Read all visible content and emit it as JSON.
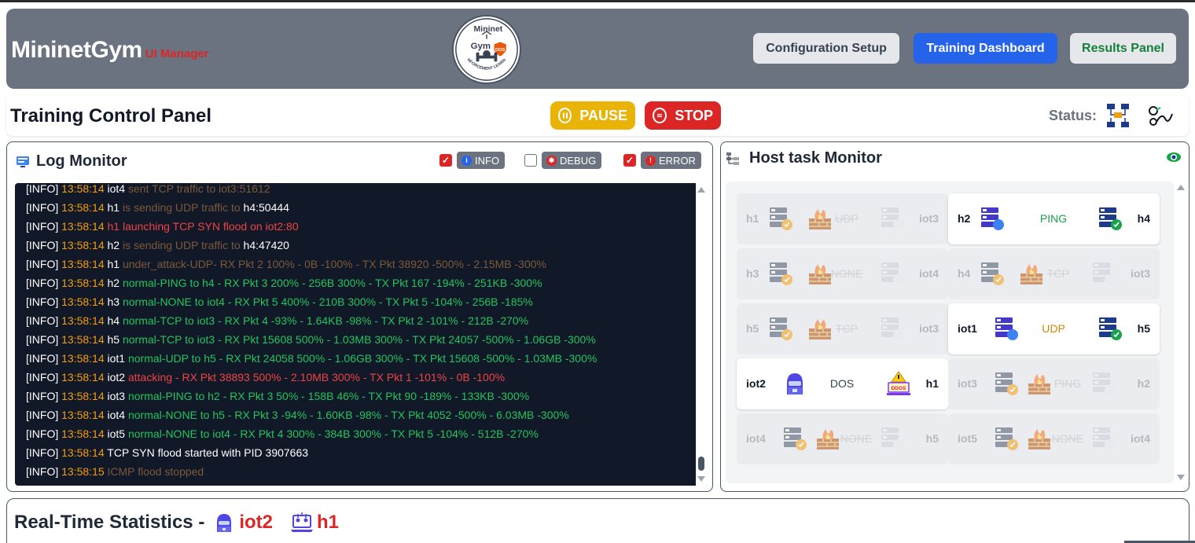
{
  "app": {
    "title": "MininetGym",
    "subtitle": "UI Manager",
    "logo_text": [
      "Mininet",
      "Gym",
      "DOS",
      "REINFORCEMENT LEARNING"
    ]
  },
  "nav": {
    "config_label": "Configuration Setup",
    "dashboard_label": "Training Dashboard",
    "results_label": "Results Panel"
  },
  "control": {
    "title": "Training Control Panel",
    "pause_label": "PAUSE",
    "stop_label": "STOP",
    "status_label": "Status:"
  },
  "log_monitor": {
    "title": "Log Monitor",
    "filters": [
      {
        "label": "INFO",
        "checked": true,
        "dot_color": "#2563eb",
        "icon": "info-icon"
      },
      {
        "label": "DEBUG",
        "checked": false,
        "dot_color": "#dc2626",
        "icon": "bug-icon"
      },
      {
        "label": "ERROR",
        "checked": true,
        "dot_color": "#dc2626",
        "icon": "alert-icon"
      }
    ],
    "lines": [
      {
        "level": "[INFO]",
        "time": "13:58:14",
        "host": "iot4",
        "msg": " sent TCP traffic to iot3:51612",
        "style": "dim"
      },
      {
        "level": "[INFO]",
        "time": "13:58:14",
        "host": "h1",
        "msg": " is sending UDP traffic to ",
        "target": "h4:50444",
        "style": "dim"
      },
      {
        "level": "[INFO]",
        "time": "13:58:14",
        "host": "h1 launching TCP SYN flood on iot2:80",
        "msg": "",
        "style": "red"
      },
      {
        "level": "[INFO]",
        "time": "13:58:14",
        "host": "h2",
        "msg": " is sending UDP traffic to ",
        "target": "h4:47420",
        "style": "dim"
      },
      {
        "level": "[INFO]",
        "time": "13:58:14",
        "host": "h1",
        "msg": " under_attack-UDP- RX Pkt 2 100% - 0B -100% - TX Pkt 38920 -500% - 2.15MB -300%",
        "style": "dim"
      },
      {
        "level": "[INFO]",
        "time": "13:58:14",
        "host": "h2",
        "msg": " normal-PING to h4 - RX Pkt 3 200% - 256B 300% - TX Pkt 167 -194% - 251KB -300%",
        "style": "green"
      },
      {
        "level": "[INFO]",
        "time": "13:58:14",
        "host": "h3",
        "msg": " normal-NONE to iot4 - RX Pkt 5 400% - 210B 300% - TX Pkt 5 -104% - 256B -185%",
        "style": "green"
      },
      {
        "level": "[INFO]",
        "time": "13:58:14",
        "host": "h4",
        "msg": " normal-TCP to iot3 - RX Pkt 4 -93% - 1.64KB -98% - TX Pkt 2 -101% - 212B -270%",
        "style": "green"
      },
      {
        "level": "[INFO]",
        "time": "13:58:14",
        "host": "h5",
        "msg": " normal-TCP to iot3 - RX Pkt 15608 500% - 1.03MB 300% - TX Pkt 24057 -500% - 1.06GB -300%",
        "style": "green"
      },
      {
        "level": "[INFO]",
        "time": "13:58:14",
        "host": "iot1",
        "msg": " normal-UDP to h5 - RX Pkt 24058 500% - 1.06GB 300% - TX Pkt 15608 -500% - 1.03MB -300%",
        "style": "green"
      },
      {
        "level": "[INFO]",
        "time": "13:58:14",
        "host": "iot2",
        "msg": " attacking - RX Pkt 38893 500% - 2.10MB 300% - TX Pkt 1 -101% - 0B -100%",
        "style": "red"
      },
      {
        "level": "[INFO]",
        "time": "13:58:14",
        "host": "iot3",
        "msg": " normal-PING to h2 - RX Pkt 3 50% - 158B 46% - TX Pkt 90 -189% - 133KB -300%",
        "style": "green"
      },
      {
        "level": "[INFO]",
        "time": "13:58:14",
        "host": "iot4",
        "msg": " normal-NONE to h5 - RX Pkt 3 -94% - 1.60KB -98% - TX Pkt 4052 -500% - 6.03MB -300%",
        "style": "green"
      },
      {
        "level": "[INFO]",
        "time": "13:58:14",
        "host": "iot5",
        "msg": " normal-NONE to iot4 - RX Pkt 4 300% - 384B 300% - TX Pkt 5 -104% - 512B -270%",
        "style": "green"
      },
      {
        "level": "[INFO]",
        "time": "13:58:14",
        "host": "TCP SYN flood started with PID 3907663",
        "msg": "",
        "style": "white"
      },
      {
        "level": "[INFO]",
        "time": "13:58:15",
        "host": "",
        "msg": "ICMP flood stopped",
        "style": "dim"
      }
    ]
  },
  "host_monitor": {
    "title": "Host task Monitor",
    "cards": [
      {
        "src": "h1",
        "task": "UDP",
        "dst": "iot3",
        "active": false,
        "task_color": "#16a34a"
      },
      {
        "src": "h2",
        "task": "PING",
        "dst": "h4",
        "active": true,
        "task_color": "#16a34a"
      },
      {
        "src": "h3",
        "task": "NONE",
        "dst": "iot4",
        "active": false,
        "task_color": "#16a34a"
      },
      {
        "src": "h4",
        "task": "TCP",
        "dst": "iot3",
        "active": false,
        "task_color": "#16a34a"
      },
      {
        "src": "h5",
        "task": "TCP",
        "dst": "iot3",
        "active": false,
        "task_color": "#16a34a"
      },
      {
        "src": "iot1",
        "task": "UDP",
        "dst": "h5",
        "active": true,
        "task_color": "#ca8a04"
      },
      {
        "src": "iot2",
        "task": "DOS",
        "dst": "h1",
        "active": true,
        "task_color": "#374151"
      },
      {
        "src": "iot3",
        "task": "PING",
        "dst": "h2",
        "active": false,
        "task_color": "#16a34a"
      },
      {
        "src": "iot4",
        "task": "NONE",
        "dst": "h5",
        "active": false,
        "task_color": "#16a34a"
      },
      {
        "src": "iot5",
        "task": "NONE",
        "dst": "iot4",
        "active": false,
        "task_color": "#16a34a"
      }
    ]
  },
  "stats": {
    "title": "Real-Time Statistics -",
    "attacker": "iot2",
    "victim": "h1"
  },
  "colors": {
    "header_bg": "#6b7280",
    "primary": "#2563eb",
    "danger": "#dc2626",
    "warning": "#eab308",
    "success": "#16a34a",
    "log_bg": "#111827"
  }
}
